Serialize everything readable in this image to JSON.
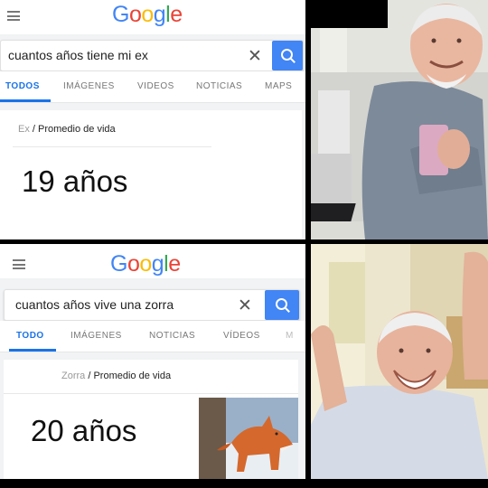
{
  "panel1": {
    "logo": [
      "G",
      "o",
      "o",
      "g",
      "l",
      "e"
    ],
    "query": "cuantos años tiene mi ex",
    "clear_icon": "close-icon",
    "search_icon": "search-icon",
    "tabs": [
      "TODOS",
      "IMÁGENES",
      "VIDEOS",
      "NOTICIAS",
      "MAPS"
    ],
    "breadcrumb_entity": "Ex",
    "breadcrumb_sep": "/",
    "breadcrumb_attr": "Promedio de vida",
    "answer": "19 años"
  },
  "panel2": {
    "logo": [
      "G",
      "o",
      "o",
      "g",
      "l",
      "e"
    ],
    "query": "cuantos años vive una zorra",
    "clear_icon": "close-icon",
    "search_icon": "search-icon",
    "tabs": [
      "TODO",
      "IMÁGENES",
      "NOTICIAS",
      "VÍDEOS",
      "M"
    ],
    "breadcrumb_entity": "Zorra",
    "breadcrumb_sep": "/",
    "breadcrumb_attr": "Promedio de vida",
    "answer": "20 años"
  },
  "colors": {
    "blue": "#4285f4",
    "red": "#ea4335",
    "yellow": "#fbbc05",
    "green": "#34a853",
    "accent": "#1a73e8"
  }
}
